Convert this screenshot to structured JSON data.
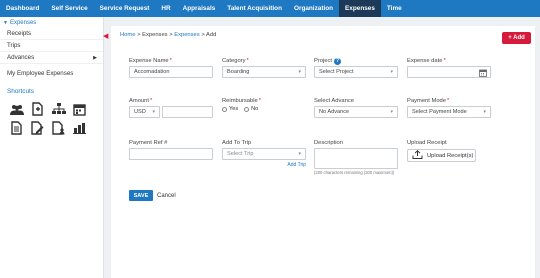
{
  "nav": {
    "items": [
      {
        "label": "Dashboard"
      },
      {
        "label": "Self Service"
      },
      {
        "label": "Service Request"
      },
      {
        "label": "HR"
      },
      {
        "label": "Appraisals"
      },
      {
        "label": "Talent Acquisition"
      },
      {
        "label": "Organization"
      },
      {
        "label": "Expenses"
      },
      {
        "label": "Time"
      }
    ],
    "active_index": 7
  },
  "sidebar": {
    "section_title": "Expenses",
    "items": [
      {
        "label": "Receipts"
      },
      {
        "label": "Trips"
      },
      {
        "label": "Advances"
      }
    ],
    "my_expenses": "My Employee Expenses",
    "shortcuts_title": "Shortcuts",
    "shortcut_icons": [
      "team-icon",
      "document-add-icon",
      "org-chart-icon",
      "calendar-icon",
      "document-list-icon",
      "document-edit-icon",
      "document-user-icon",
      "bar-chart-icon"
    ]
  },
  "breadcrumb": {
    "home": "Home",
    "sep": ">",
    "level1": "Expenses",
    "level2": "Expenses",
    "current": "Add"
  },
  "add_button": "+ Add",
  "form": {
    "expense_name": {
      "label": "Expense Name",
      "value": "Accomadation"
    },
    "category": {
      "label": "Category",
      "value": "Boarding"
    },
    "project": {
      "label": "Project",
      "placeholder": "Select Project"
    },
    "expense_date": {
      "label": "Expense date",
      "value": ""
    },
    "amount": {
      "label": "Amount",
      "currency": "USD",
      "value": ""
    },
    "reimbursable": {
      "label": "Reimbursable",
      "options": [
        "Yes",
        "No"
      ]
    },
    "select_advance": {
      "label": "Select Advance",
      "value": "No Advance"
    },
    "payment_mode": {
      "label": "Payment Mode",
      "placeholder": "Select Payment Mode"
    },
    "payment_ref": {
      "label": "Payment Ref #",
      "value": ""
    },
    "add_to_trip": {
      "label": "Add To Trip",
      "placeholder": "Select Trip",
      "link": "Add Trip"
    },
    "description": {
      "label": "Description",
      "counter": "(200 characters remaining (200 maximum))"
    },
    "upload_receipt": {
      "label": "Upload Receipt",
      "button": "Upload Receipt(s)"
    }
  },
  "actions": {
    "save": "SAVE",
    "cancel": "Cancel"
  },
  "colors": {
    "nav_blue": "#1e78c2",
    "nav_active": "#1c3a57",
    "accent_red": "#d61a3c"
  }
}
